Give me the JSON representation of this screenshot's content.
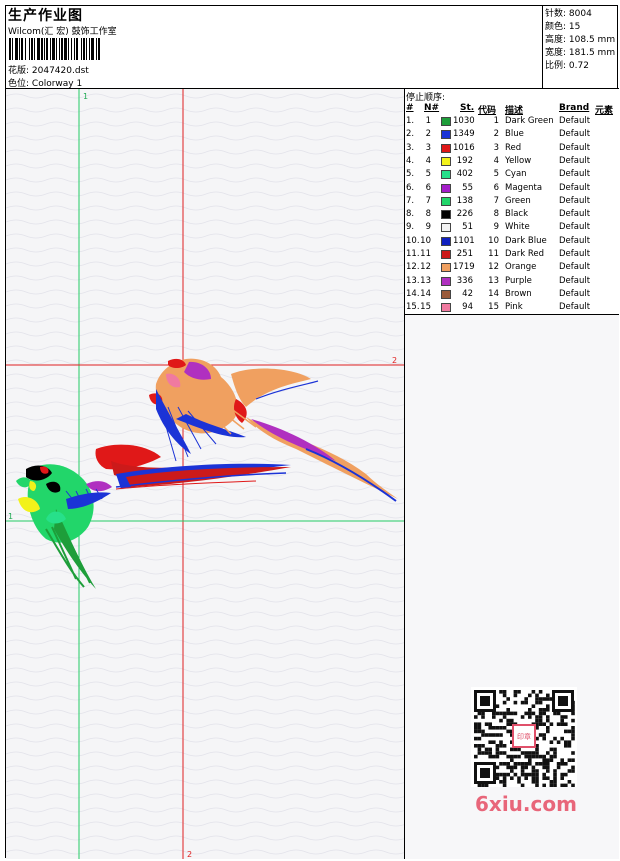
{
  "header": {
    "title": "生产作业图",
    "studio": "Wilcom(汇 宏) 鼓饰工作室",
    "design_label": "花版: ",
    "design_value": "2047420.dst",
    "colorway_label": "色位: ",
    "colorway_value": "Colorway 1"
  },
  "stats": [
    {
      "label": "针数:",
      "value": "8004"
    },
    {
      "label": "颜色:",
      "value": "15"
    },
    {
      "label": "高度:",
      "value": "108.5 mm"
    },
    {
      "label": "宽度:",
      "value": "181.5 mm"
    },
    {
      "label": "比例:",
      "value": "0.72"
    }
  ],
  "stop_sequence": {
    "title": "停止顺序:",
    "columns": [
      "#",
      "N#",
      "St.",
      "代码",
      "描述",
      "Brand",
      "元素"
    ],
    "rows": [
      {
        "idx": "1.",
        "n": "1",
        "color": "#1e9e3a",
        "st": "1030",
        "code": "1",
        "desc": "Dark Green",
        "brand": "Default"
      },
      {
        "idx": "2.",
        "n": "2",
        "color": "#1b33d6",
        "st": "1349",
        "code": "2",
        "desc": "Blue",
        "brand": "Default"
      },
      {
        "idx": "3.",
        "n": "3",
        "color": "#e01818",
        "st": "1016",
        "code": "3",
        "desc": "Red",
        "brand": "Default"
      },
      {
        "idx": "4.",
        "n": "4",
        "color": "#f2f21a",
        "st": "192",
        "code": "4",
        "desc": "Yellow",
        "brand": "Default"
      },
      {
        "idx": "5.",
        "n": "5",
        "color": "#27e08a",
        "st": "402",
        "code": "5",
        "desc": "Cyan",
        "brand": "Default"
      },
      {
        "idx": "6.",
        "n": "6",
        "color": "#a41ec9",
        "st": "55",
        "code": "6",
        "desc": "Magenta",
        "brand": "Default"
      },
      {
        "idx": "7.",
        "n": "7",
        "color": "#22d66a",
        "st": "138",
        "code": "7",
        "desc": "Green",
        "brand": "Default"
      },
      {
        "idx": "8.",
        "n": "8",
        "color": "#000000",
        "st": "226",
        "code": "8",
        "desc": "Black",
        "brand": "Default"
      },
      {
        "idx": "9.",
        "n": "9",
        "color": "#f4f4f4",
        "st": "51",
        "code": "9",
        "desc": "White",
        "brand": "Default"
      },
      {
        "idx": "10.",
        "n": "10",
        "color": "#1020c0",
        "st": "1101",
        "code": "10",
        "desc": "Dark Blue",
        "brand": "Default"
      },
      {
        "idx": "11.",
        "n": "11",
        "color": "#cc1a1a",
        "st": "251",
        "code": "11",
        "desc": "Dark Red",
        "brand": "Default"
      },
      {
        "idx": "12.",
        "n": "12",
        "color": "#f0a060",
        "st": "1719",
        "code": "12",
        "desc": "Orange",
        "brand": "Default"
      },
      {
        "idx": "13.",
        "n": "13",
        "color": "#b030c0",
        "st": "336",
        "code": "13",
        "desc": "Purple",
        "brand": "Default"
      },
      {
        "idx": "14.",
        "n": "14",
        "color": "#9a5a3a",
        "st": "42",
        "code": "14",
        "desc": "Brown",
        "brand": "Default"
      },
      {
        "idx": "15.",
        "n": "15",
        "color": "#f07aa0",
        "st": "94",
        "code": "15",
        "desc": "Pink",
        "brand": "Default"
      }
    ]
  },
  "guides": {
    "v1_label": "1",
    "v2_label": "2",
    "h1_label": "1",
    "h2_label": "2",
    "green": "#22cc66",
    "red": "#e02020"
  },
  "watermark": {
    "site": "6xiu.com",
    "qr_badge": "印章"
  }
}
